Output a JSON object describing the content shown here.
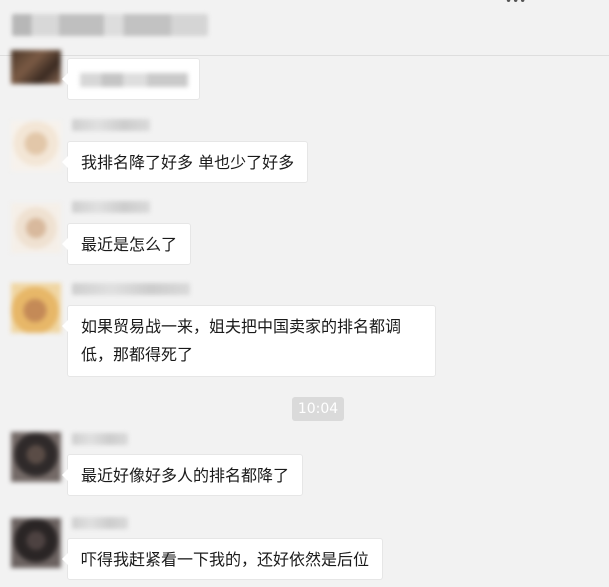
{
  "header": {
    "more_icon": "more-dots-icon"
  },
  "messages": [
    {
      "text": ""
    },
    {
      "text": "我排名降了好多 单也少了好多"
    },
    {
      "text": "最近是怎么了"
    },
    {
      "text": "如果贸易战一来，姐夫把中国卖家的排名都调低，那都得死了"
    },
    {
      "text": "最近好像好多人的排名都降了"
    },
    {
      "text": "吓得我赶紧看一下我的，还好依然是后位"
    }
  ],
  "timestamp": "10:04"
}
